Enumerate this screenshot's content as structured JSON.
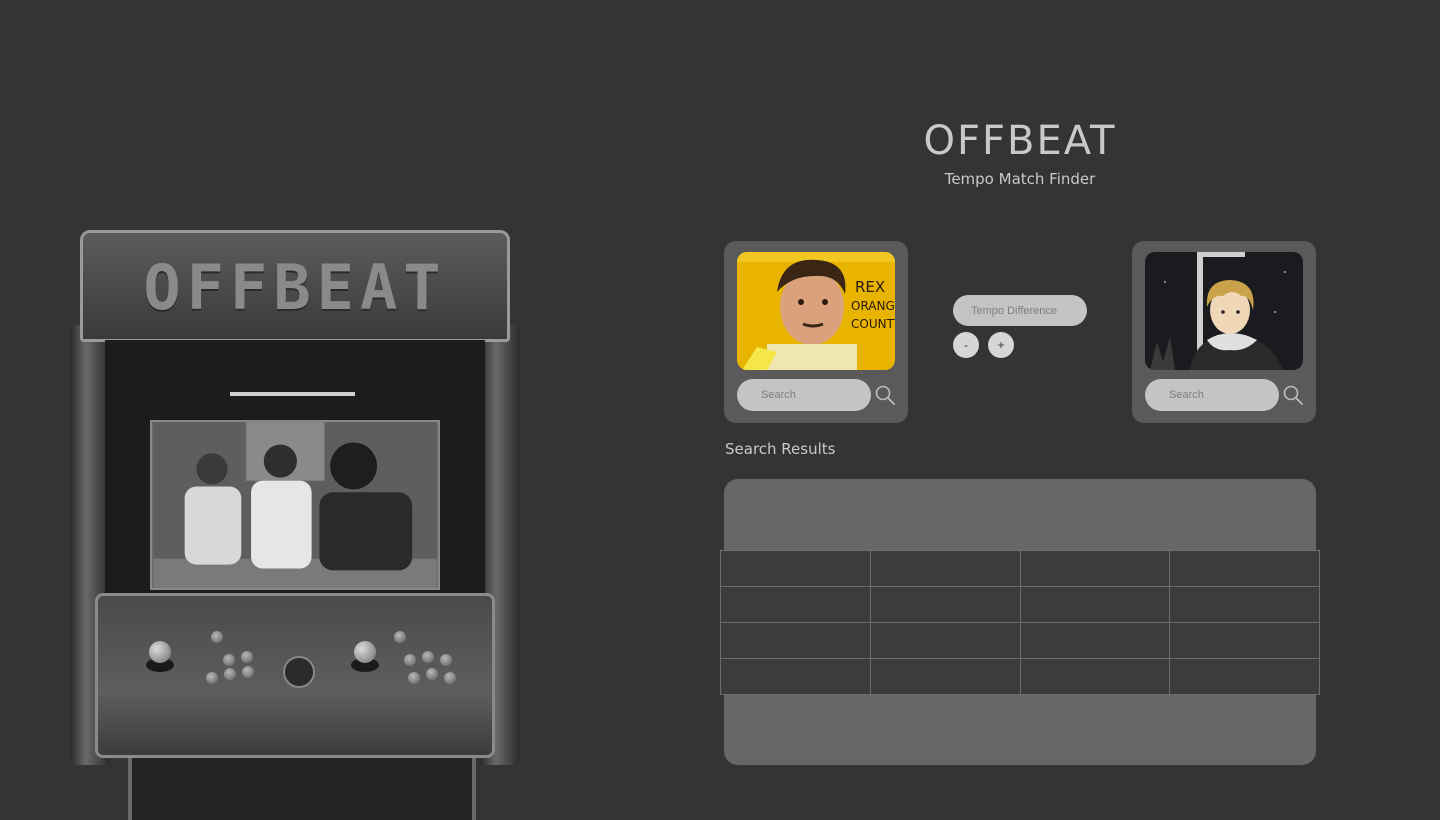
{
  "app": {
    "title": "OFFBEAT",
    "subtitle": "Tempo Match Finder"
  },
  "cabinet": {
    "marquee_text": "OFFBEAT"
  },
  "song_left": {
    "cover_icon": "album-cover-rex-orange-county",
    "cover_text_1": "REX",
    "cover_text_2": "ORANGE",
    "cover_text_3": "COUNTY",
    "search_placeholder": "Search"
  },
  "song_right": {
    "cover_icon": "album-cover-anime-character",
    "search_placeholder": "Search"
  },
  "tempo": {
    "placeholder": "Tempo Difference",
    "minus_label": "-",
    "plus_label": "+"
  },
  "results": {
    "label": "Search Results",
    "rows": [
      [
        "",
        "",
        "",
        ""
      ],
      [
        "",
        "",
        "",
        ""
      ],
      [
        "",
        "",
        "",
        ""
      ],
      [
        "",
        "",
        "",
        ""
      ]
    ]
  },
  "colors": {
    "background": "#343434",
    "card": "#5a5a5a",
    "pill": "#c4c4c4",
    "panel": "#676767",
    "text": "#c9c9c9"
  }
}
